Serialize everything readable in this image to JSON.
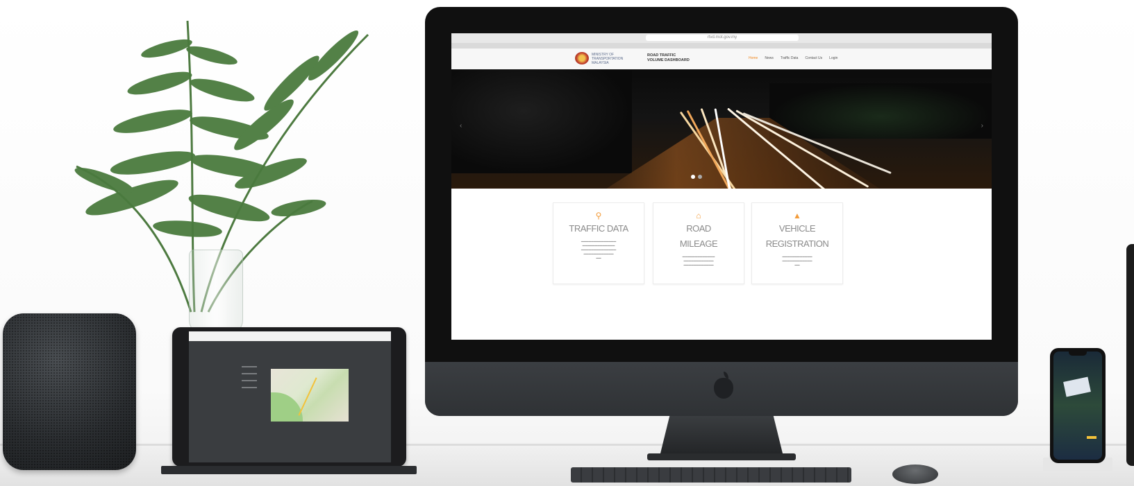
{
  "browser": {
    "url": "rtvd.mot.gov.my",
    "tab_count": 4
  },
  "site": {
    "ministry_lines": [
      "MINISTRY OF",
      "TRANSPORTATION",
      "MALAYSIA"
    ],
    "system_name_lines": [
      "ROAD TRAFFIC",
      "VOLUME DASHBOARD"
    ],
    "nav": [
      "Home",
      "News",
      "Traffic Data",
      "Contact Us",
      "Login"
    ]
  },
  "hero": {
    "description": "night highway light trails",
    "indicator_dots": 2
  },
  "cards": [
    {
      "icon": "search-icon",
      "title": "TRAFFIC DATA",
      "text": ""
    },
    {
      "icon": "home-icon",
      "title": "ROAD",
      "subtitle": "MILEAGE",
      "text": ""
    },
    {
      "icon": "car-icon",
      "title": "VEHICLE",
      "subtitle": "REGISTRATION",
      "text": ""
    }
  ],
  "colors": {
    "accent": "#f39c3b",
    "imac_body": "#101010",
    "chin": "#34373a",
    "desk": "#eeeeee"
  },
  "devices": [
    "homepod-speaker",
    "ipad-tablet",
    "imac-desktop",
    "iphone",
    "keyboard",
    "mouse"
  ]
}
